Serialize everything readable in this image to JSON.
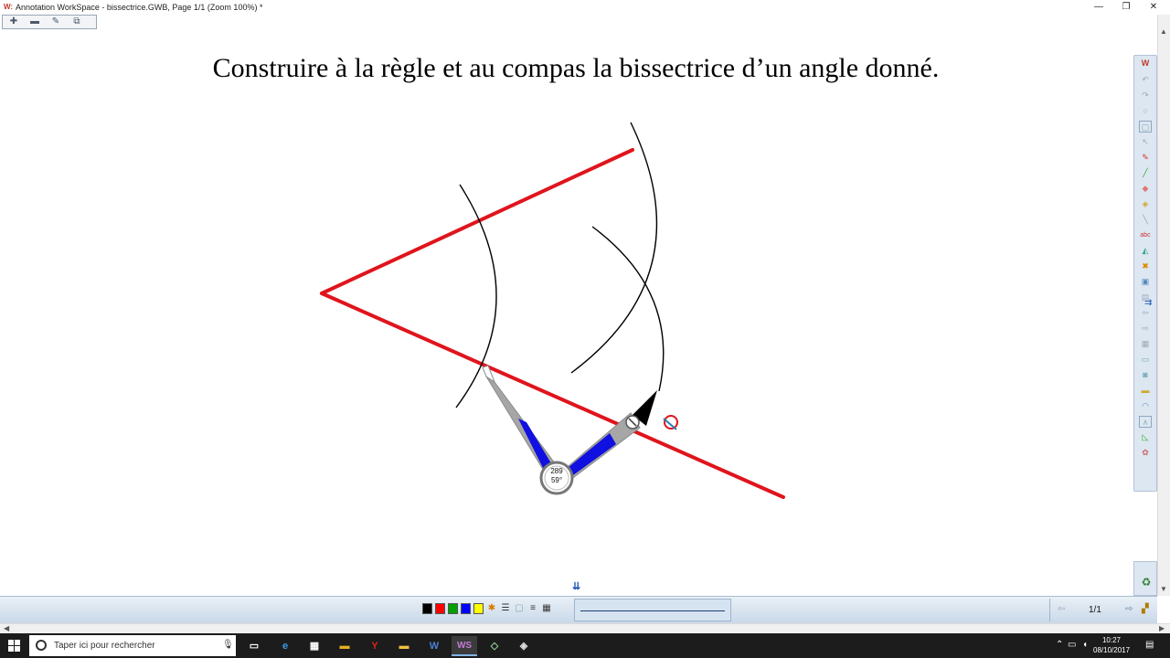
{
  "window": {
    "app_logo": "W:",
    "title": "Annotation WorkSpace - bissectrice.GWB, Page 1/1  (Zoom 100%) *",
    "minimize_icon": "minimize-icon",
    "maximize_icon": "maximize-icon",
    "close_icon": "close-icon"
  },
  "mini_toolbar": [
    "zoom-in-icon",
    "zoom-out-icon",
    "edit-page-icon",
    "copy-page-icon"
  ],
  "heading": "Construire à la règle et au compas la bissectrice d’un angle donné.",
  "compass": {
    "readout_length": "289",
    "readout_angle": "59°"
  },
  "colors": {
    "angle_lines": "#e0141c",
    "arcs": "#000000",
    "compass_arm": "#a6a6a6",
    "compass_fill": "#1010e0",
    "toolbar_bg": "#dde7f1"
  },
  "sidebar_tools": [
    "logo-icon",
    "undo-icon",
    "redo-icon",
    "circle-icon",
    "page-icon",
    "pointer-icon",
    "pen-icon",
    "highlighter-icon",
    "eraser-icon",
    "fill-icon",
    "ruler-icon",
    "text-icon",
    "shape-icon",
    "delete-icon",
    "screen-icon",
    "insert-icon",
    "back-icon",
    "forward-icon",
    "grid-icon",
    "save-icon",
    "camera-icon",
    "line-icon",
    "protractor-icon",
    "compass-icon",
    "triangle-icon",
    "settings-icon"
  ],
  "recycle_icon": "recycle-bin-icon",
  "palette": {
    "colors": [
      "#000000",
      "#ff0000",
      "#00a000",
      "#0000ff",
      "#ffff00"
    ],
    "tools": [
      "custom-color-icon",
      "line-width-icon",
      "line-style-icon",
      "transparency-icon",
      "pattern-icon"
    ]
  },
  "page_nav": {
    "count": "1/1",
    "prev_icon": "previous-page-icon",
    "next_icon": "next-page-icon",
    "extra_icon": "page-sorter-icon"
  },
  "taskbar": {
    "search_placeholder": "Taper ici pour rechercher",
    "apps": [
      {
        "name": "task-view",
        "label": "▭"
      },
      {
        "name": "edge",
        "label": "e"
      },
      {
        "name": "store",
        "label": "▦"
      },
      {
        "name": "folder-app",
        "label": "▬"
      },
      {
        "name": "red-app",
        "label": "Y"
      },
      {
        "name": "explorer",
        "label": "▬"
      },
      {
        "name": "word",
        "label": "W"
      },
      {
        "name": "workspace",
        "label": "WS"
      },
      {
        "name": "app-9",
        "label": "◇"
      },
      {
        "name": "app-10",
        "label": "◈"
      }
    ],
    "time": "10:27",
    "date": "08/10/2017"
  }
}
